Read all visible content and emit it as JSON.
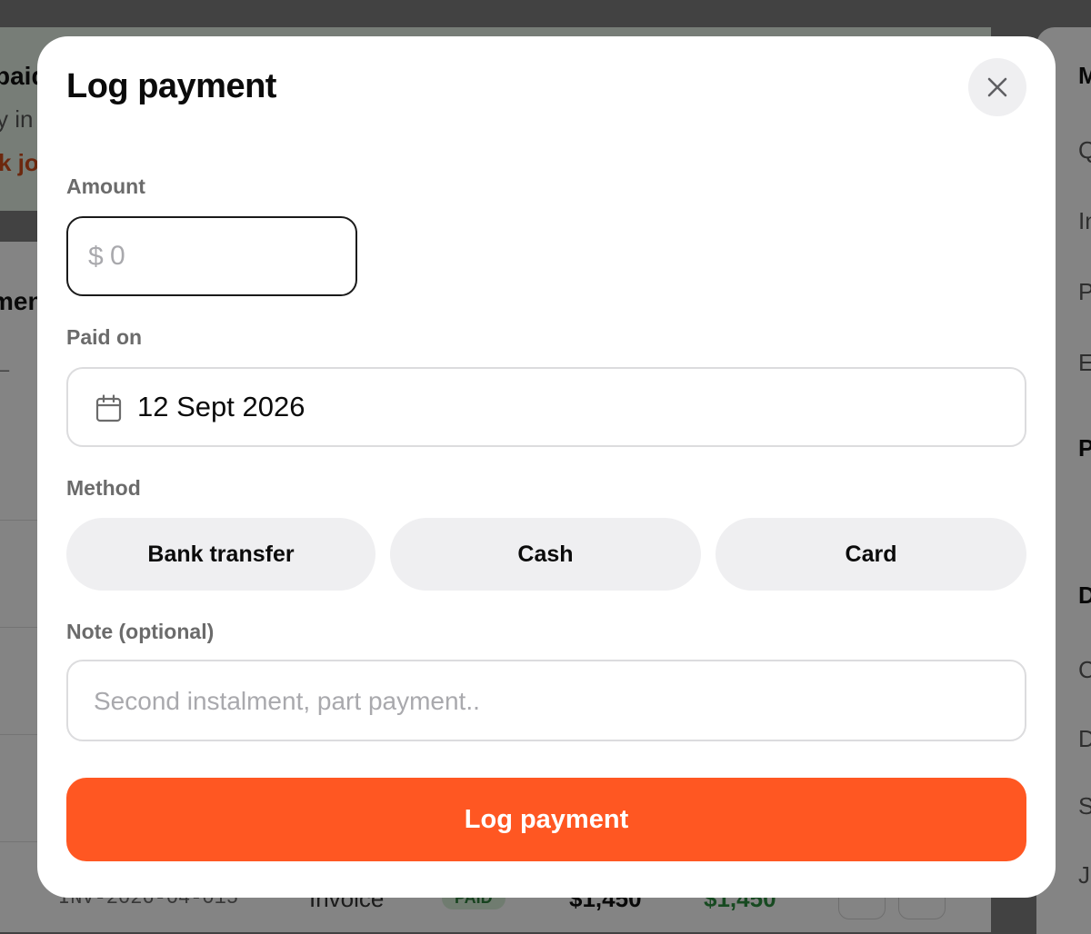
{
  "background": {
    "banner_title": "paid",
    "banner_sub": "y in",
    "banner_link": "k jo",
    "card_title": "men",
    "row": {
      "invoice_no": "INV-2026-04-015",
      "kind": "Invoice",
      "badge": "PAID",
      "amount": "$1,450",
      "amount_paid": "$1,450"
    },
    "side_items": [
      "M",
      "Q",
      "In",
      "P",
      "E",
      "P",
      "D",
      "C",
      "D",
      "S",
      "J"
    ]
  },
  "modal": {
    "title": "Log payment",
    "close_icon": "close-icon",
    "amount": {
      "label": "Amount",
      "prefix": "$",
      "placeholder": "0",
      "value": ""
    },
    "paid_on": {
      "label": "Paid on",
      "icon": "calendar-icon",
      "value": "12 Sept 2026"
    },
    "method": {
      "label": "Method",
      "options": [
        "Bank transfer",
        "Cash",
        "Card"
      ]
    },
    "note": {
      "label": "Note (optional)",
      "placeholder": "Second instalment, part payment..",
      "value": ""
    },
    "submit_label": "Log payment"
  },
  "colors": {
    "accent": "#ff5722",
    "chip_bg": "#efeff1",
    "label_gray": "#6b6b6b",
    "placeholder_gray": "#a9a9ad"
  }
}
